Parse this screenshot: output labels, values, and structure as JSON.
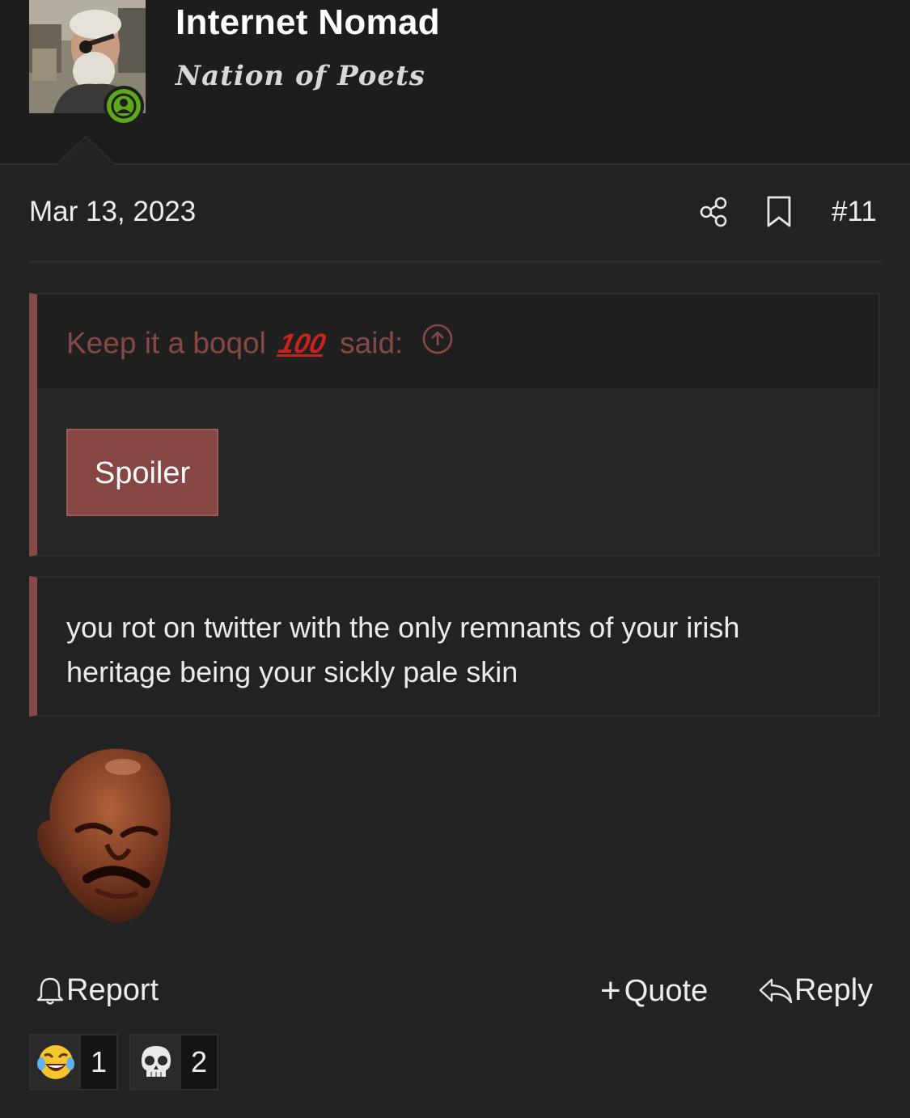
{
  "user": {
    "name": "Internet Nomad",
    "title": "Nation of Poets"
  },
  "post": {
    "date": "Mar 13, 2023",
    "number": "#11",
    "quote": {
      "author": "Keep it a boqol",
      "emoji_text": "100",
      "said": "said:",
      "spoiler_label": "Spoiler"
    },
    "quoted_text": "you rot on twitter with the only remnants of your irish heritage being your sickly pale skin",
    "image": "crying-face-meme"
  },
  "actions": {
    "report": "Report",
    "quote": "Quote",
    "reply": "Reply"
  },
  "reactions": [
    {
      "icon": "laughing-tears-emoji",
      "count": "1"
    },
    {
      "icon": "skull-emoji",
      "count": "2"
    }
  ],
  "colors": {
    "accent": "#874946",
    "online": "#5ea81b",
    "background": "#222223"
  }
}
